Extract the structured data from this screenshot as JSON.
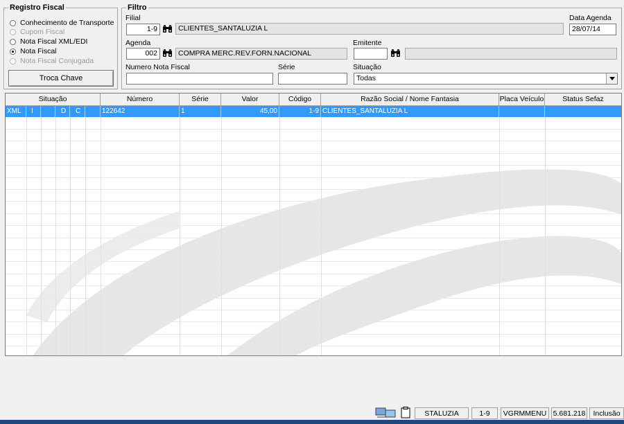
{
  "registro": {
    "title": "Registro Fiscal",
    "options": [
      {
        "label": "Conhecimento de Transporte",
        "selected": false,
        "enabled": true
      },
      {
        "label": "Cupom Fiscal",
        "selected": false,
        "enabled": false
      },
      {
        "label": "Nota Fiscal XML/EDI",
        "selected": false,
        "enabled": true
      },
      {
        "label": "Nota Fiscal",
        "selected": true,
        "enabled": true
      },
      {
        "label": "Nota Fiscal Conjugada",
        "selected": false,
        "enabled": false
      }
    ],
    "troca_chave": "Troca Chave"
  },
  "filtro": {
    "title": "Filtro",
    "filial_label": "Filial",
    "filial_code": "1-9",
    "filial_name": "CLIENTES_SANTALUZIA L",
    "data_agenda_label": "Data Agenda",
    "data_agenda": "28/07/14",
    "agenda_label": "Agenda",
    "agenda_code": "002",
    "agenda_name": "COMPRA MERC.REV.FORN.NACIONAL",
    "emitente_label": "Emitente",
    "emitente_code": "",
    "emitente_name": "",
    "numero_label": "Numero Nota Fiscal",
    "numero_value": "",
    "serie_label": "Série",
    "serie_value": "",
    "situacao_label": "Situação",
    "situacao_value": "Todas"
  },
  "grid": {
    "headers": [
      "Situação",
      "Número",
      "Série",
      "Valor",
      "Código",
      "Razão Social / Nome Fantasia",
      "Placa Veículo",
      "Status Sefaz"
    ],
    "rows": [
      {
        "flags": [
          "XML",
          "I",
          "",
          "D",
          "C",
          ""
        ],
        "numero": "122642",
        "serie": "1",
        "valor": "45,00",
        "codigo": "1-9",
        "razao": "CLIENTES_SANTALUZIA L",
        "placa": "",
        "status": ""
      }
    ]
  },
  "statusbar": {
    "user": "STALUZIA",
    "filial": "1-9",
    "module": "VGRMMENU",
    "number": "5.681.218",
    "mode": "Inclusão"
  },
  "icons": [
    "binoculars-icon",
    "dropdown-arrow-icon",
    "network-icon",
    "clipboard-icon"
  ],
  "colors": {
    "selection": "#3399ff",
    "window": "#f0f0f0",
    "taskbar": "#1d4a7a"
  }
}
